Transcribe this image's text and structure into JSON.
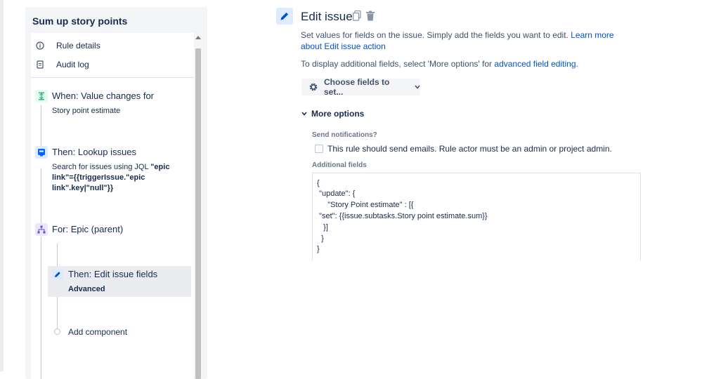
{
  "rule": {
    "title": "Sum up story points",
    "nav": [
      {
        "label": "Rule details",
        "icon": "info-icon"
      },
      {
        "label": "Audit log",
        "icon": "document-icon"
      }
    ],
    "steps": [
      {
        "title": "When: Value changes for",
        "subtitle": "Story point estimate",
        "icon": "trigger-icon"
      },
      {
        "title": "Then: Lookup issues",
        "subtitle_prefix": "Search for issues using JQL",
        "subtitle_bold": "\"epic link\"={{triggerIssue.\"epic link\".key|\"null\"}}",
        "icon": "lookup-icon"
      },
      {
        "title": "For: Epic (parent)",
        "icon": "branch-icon"
      },
      {
        "title": "Then: Edit issue fields",
        "subtitle": "Advanced",
        "icon": "pencil-icon"
      }
    ],
    "add_component": "Add component"
  },
  "edit": {
    "title": "Edit issue",
    "description": "Set values for fields on the issue. Simply add the fields you want to edit.",
    "learn_more": "Learn more about Edit issue action",
    "display_text": "To display additional fields, select 'More options' for",
    "advanced_link": "advanced field editing",
    "period": ".",
    "choose_button": "Choose fields to set...",
    "more_options": "More options",
    "send_notifications_label": "Send notifications?",
    "checkbox_label": "This rule should send emails. Rule actor must be an admin or project admin.",
    "additional_fields_label": "Additional fields",
    "code_lines": [
      "{",
      " \"update\": {",
      "     \"Story Point estimate\" : [{",
      " \"set\": {{issue.subtasks.Story point estimate.sum}}",
      "   }]",
      "  }",
      "}"
    ]
  },
  "colors": {
    "accent": "#0052cc",
    "trigger_green": "#36b37e",
    "lookup_blue": "#0065ff",
    "branch_purple": "#6554c0"
  }
}
